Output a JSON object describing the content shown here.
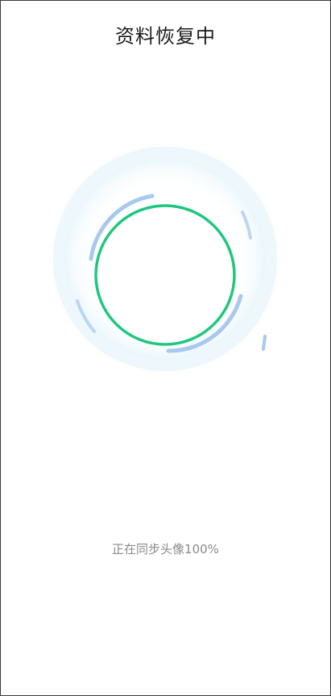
{
  "header": {
    "title": "资料恢复中"
  },
  "progress": {
    "status_text": "正在同步头像100%",
    "value": 1.0
  },
  "colors": {
    "progress_ring": "#1fc77e",
    "orbit_arc": "#a9c8ef",
    "glow": "#e6f5fb"
  },
  "icons": {
    "spinner": "sync-progress-ring"
  }
}
